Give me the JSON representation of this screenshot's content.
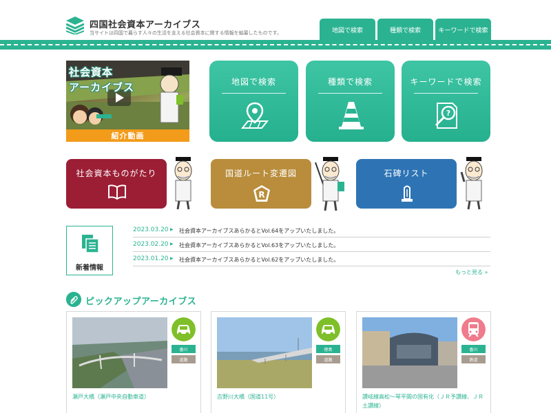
{
  "header": {
    "title": "四国社会資本アーカイブス",
    "description": "当サイトは四国で暮らす人々の生活を支える社会資本に関する情報を編纂したものです。",
    "tabs": [
      "地図で検索",
      "種類で検索",
      "キーワードで検索"
    ]
  },
  "video": {
    "title_line1": "社会資本",
    "title_line2": "アーカイブス",
    "caption": "紹介動画"
  },
  "search_buttons": [
    {
      "label": "地図で検索",
      "icon": "map-pin-icon"
    },
    {
      "label": "種類で検索",
      "icon": "traffic-cone-icon"
    },
    {
      "label": "キーワードで検索",
      "icon": "search-document-icon"
    }
  ],
  "nav_buttons": [
    {
      "label": "社会資本ものがたり",
      "icon": "book-icon",
      "color": "#9b1e35"
    },
    {
      "label": "国道ルート変遷図",
      "icon": "route-sign-icon",
      "color": "#b98d3c"
    },
    {
      "label": "石碑リスト",
      "icon": "monument-icon",
      "color": "#2e74b5"
    }
  ],
  "news": {
    "label": "新着情報",
    "items": [
      {
        "date": "2023.03.20",
        "text": "社会資本アーカイブスあらかるとVol.64をアップいたしました。"
      },
      {
        "date": "2023.02.20",
        "text": "社会資本アーカイブスあらかるとVol.63をアップいたしました。"
      },
      {
        "date": "2023.01.20",
        "text": "社会資本アーカイブスあらかるとVol.62をアップいたしました。"
      }
    ],
    "more": "もっと見る »"
  },
  "pickup": {
    "title": "ピックアップアーカイブス",
    "cards": [
      {
        "caption": "瀬戸大橋（瀬戸中央自動車道）",
        "prefecture": "香川",
        "category": "道路",
        "icon": "car-icon",
        "icon_color": "#7fbf2a"
      },
      {
        "caption": "吉野川大橋（国道11号）",
        "prefecture": "徳島",
        "category": "道路",
        "icon": "car-icon",
        "icon_color": "#7fbf2a"
      },
      {
        "caption": "讃岐線高松～琴平間の国有化（ＪＲ予讃線、ＪＲ土讃線）",
        "prefecture": "香川",
        "category": "鉄道",
        "icon": "train-icon",
        "icon_color": "#f07b8c"
      }
    ]
  },
  "colors": {
    "accent": "#2bb391",
    "orange": "#f39b1a"
  }
}
